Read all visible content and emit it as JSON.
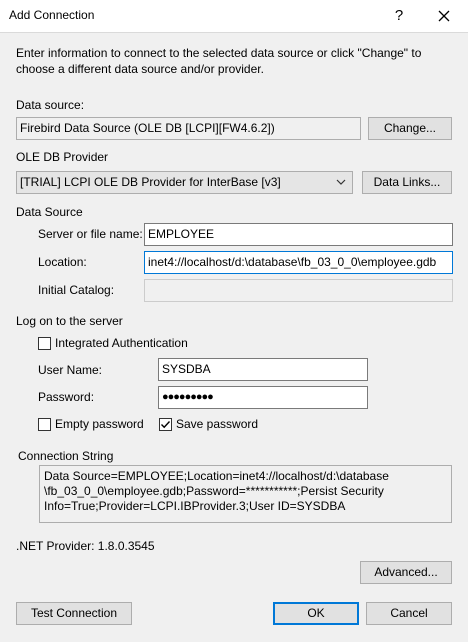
{
  "window": {
    "title": "Add Connection",
    "help_glyph": "?",
    "intro": "Enter information to connect to the selected data source or click \"Change\" to choose a different data source and/or provider."
  },
  "data_source": {
    "label": "Data source:",
    "value": "Firebird Data Source (OLE DB [LCPI][FW4.6.2])",
    "change_button": "Change..."
  },
  "provider": {
    "label": "OLE DB Provider",
    "selected": "[TRIAL] LCPI OLE DB Provider for InterBase [v3]",
    "data_links_button": "Data Links..."
  },
  "data_source_group": {
    "label": "Data Source",
    "server_label": "Server or file name:",
    "server_value": "EMPLOYEE",
    "location_label": "Location:",
    "location_value": "inet4://localhost/d:\\database\\fb_03_0_0\\employee.gdb",
    "catalog_label": "Initial Catalog:",
    "catalog_value": ""
  },
  "logon": {
    "label": "Log on to the server",
    "integrated_auth_label": "Integrated Authentication",
    "integrated_auth_checked": false,
    "user_name_label": "User Name:",
    "user_name_value": "SYSDBA",
    "password_label": "Password:",
    "password_value": "●●●●●●●●●",
    "empty_password_label": "Empty password",
    "empty_password_checked": false,
    "save_password_label": "Save password",
    "save_password_checked": true
  },
  "connection_string": {
    "label": "Connection String",
    "lines": [
      "Data Source=EMPLOYEE;Location=inet4://localhost/d:\\database",
      "\\fb_03_0_0\\employee.gdb;Password=***********;Persist Security",
      "Info=True;Provider=LCPI.IBProvider.3;User ID=SYSDBA"
    ]
  },
  "net_provider": ".NET Provider: 1.8.0.3545",
  "buttons": {
    "advanced": "Advanced...",
    "test_connection": "Test Connection",
    "ok": "OK",
    "cancel": "Cancel"
  }
}
